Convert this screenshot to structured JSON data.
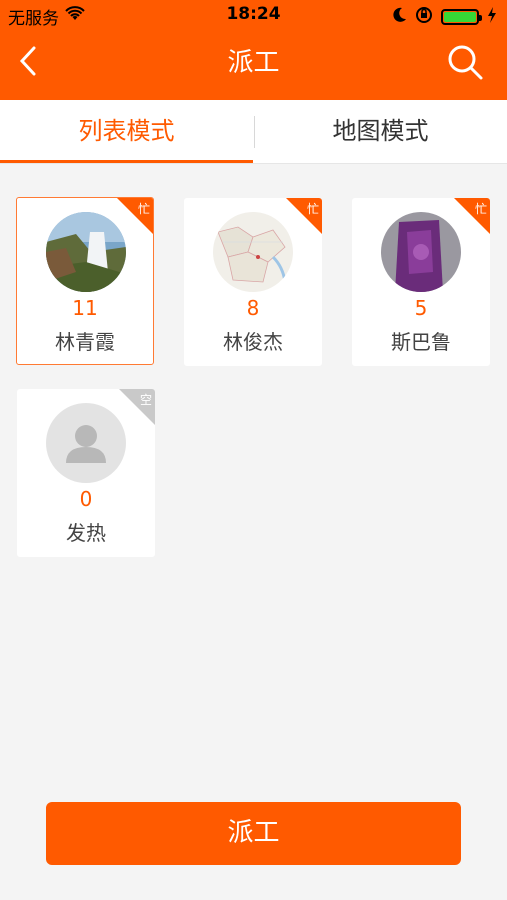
{
  "status_bar": {
    "carrier": "无服务",
    "time": "18:24",
    "battery_percent": 100
  },
  "nav": {
    "title": "派工",
    "back_icon": "chevron-left-icon",
    "search_icon": "search-icon"
  },
  "tabs": [
    {
      "label": "列表模式",
      "active": true
    },
    {
      "label": "地图模式",
      "active": false
    }
  ],
  "workers": [
    {
      "name": "林青霞",
      "count": "11",
      "status": "忙",
      "avatar": "waterfall-photo",
      "selected": true
    },
    {
      "name": "林俊杰",
      "count": "8",
      "status": "忙",
      "avatar": "map-photo",
      "selected": false
    },
    {
      "name": "斯巴鲁",
      "count": "5",
      "status": "忙",
      "avatar": "purple-photo",
      "selected": false
    },
    {
      "name": "发热",
      "count": "0",
      "status": "空",
      "avatar": "default-person",
      "selected": false
    }
  ],
  "dispatch_button": {
    "label": "派工"
  },
  "colors": {
    "accent": "#ff5a00",
    "background": "#f4f4f4",
    "idle_badge": "#c9c9c9"
  }
}
